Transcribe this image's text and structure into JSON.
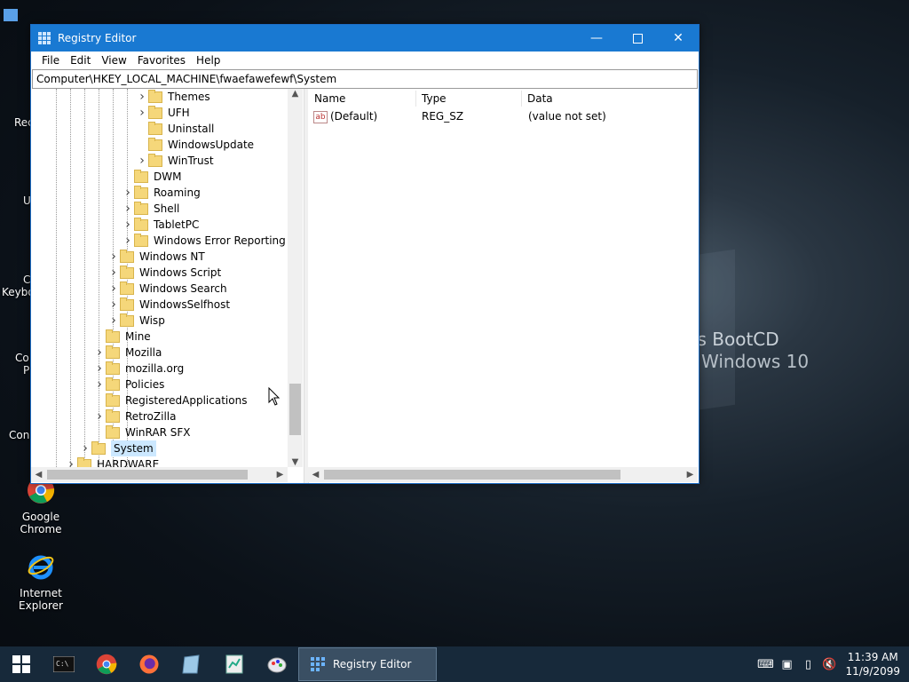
{
  "wallpaper": {
    "text1": "'s BootCD",
    "text2": "Windows 10"
  },
  "desktop_icons": [
    {
      "label": "Google Chrome"
    },
    {
      "label": "Internet Explorer"
    }
  ],
  "desktop_partial_labels": [
    "Rec",
    "U",
    "C",
    "Keybo",
    "Co",
    "P",
    "Con"
  ],
  "window": {
    "title": "Registry Editor",
    "menu": [
      "File",
      "Edit",
      "View",
      "Favorites",
      "Help"
    ],
    "address": "Computer\\HKEY_LOCAL_MACHINE\\fwaefawefewf\\System",
    "tree": [
      {
        "label": "Themes",
        "level": 4,
        "expandable": true
      },
      {
        "label": "UFH",
        "level": 4,
        "expandable": true
      },
      {
        "label": "Uninstall",
        "level": 4,
        "expandable": false
      },
      {
        "label": "WindowsUpdate",
        "level": 4,
        "expandable": false
      },
      {
        "label": "WinTrust",
        "level": 4,
        "expandable": true
      },
      {
        "label": "DWM",
        "level": 3,
        "expandable": false
      },
      {
        "label": "Roaming",
        "level": 3,
        "expandable": true
      },
      {
        "label": "Shell",
        "level": 3,
        "expandable": true
      },
      {
        "label": "TabletPC",
        "level": 3,
        "expandable": true
      },
      {
        "label": "Windows Error Reporting",
        "level": 3,
        "expandable": true
      },
      {
        "label": "Windows NT",
        "level": 2,
        "expandable": true
      },
      {
        "label": "Windows Script",
        "level": 2,
        "expandable": true
      },
      {
        "label": "Windows Search",
        "level": 2,
        "expandable": true
      },
      {
        "label": "WindowsSelfhost",
        "level": 2,
        "expandable": true
      },
      {
        "label": "Wisp",
        "level": 2,
        "expandable": true
      },
      {
        "label": "Mine",
        "level": 1,
        "expandable": false
      },
      {
        "label": "Mozilla",
        "level": 1,
        "expandable": true
      },
      {
        "label": "mozilla.org",
        "level": 1,
        "expandable": true
      },
      {
        "label": "Policies",
        "level": 1,
        "expandable": true
      },
      {
        "label": "RegisteredApplications",
        "level": 1,
        "expandable": false
      },
      {
        "label": "RetroZilla",
        "level": 1,
        "expandable": true
      },
      {
        "label": "WinRAR SFX",
        "level": 1,
        "expandable": false
      },
      {
        "label": "System",
        "level": 0,
        "expandable": true,
        "selected": true
      },
      {
        "label": "HARDWARE",
        "level": -1,
        "expandable": true
      }
    ],
    "columns": {
      "name": "Name",
      "type": "Type",
      "data": "Data"
    },
    "values": [
      {
        "name": "(Default)",
        "type": "REG_SZ",
        "data": "(value not set)"
      }
    ]
  },
  "taskbar": {
    "active_app": "Registry Editor",
    "time": "11:39 AM",
    "date": "11/9/2099"
  }
}
